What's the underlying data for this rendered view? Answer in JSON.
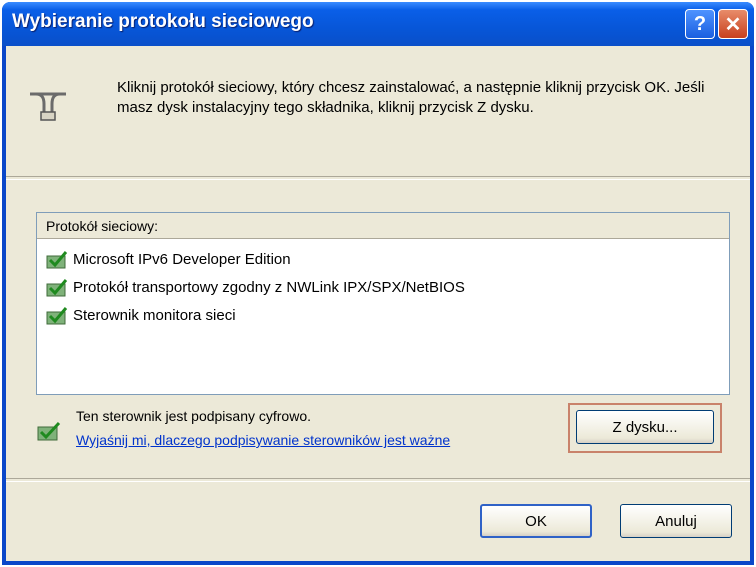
{
  "window": {
    "title": "Wybieranie protokołu sieciowego",
    "help_label": "?",
    "close_label": "✕"
  },
  "intro": {
    "text": "Kliknij protokół sieciowy, który chcesz zainstalować, a następnie kliknij przycisk OK. Jeśli masz dysk instalacyjny tego składnika, kliknij przycisk Z dysku."
  },
  "list": {
    "header": "Protokół sieciowy:",
    "items": [
      {
        "label": "Microsoft IPv6 Developer Edition",
        "icon": "network-protocol-icon"
      },
      {
        "label": "Protokół transportowy zgodny z NWLink IPX/SPX/NetBIOS",
        "icon": "network-protocol-icon"
      },
      {
        "label": "Sterownik monitora sieci",
        "icon": "network-protocol-icon"
      }
    ]
  },
  "signature": {
    "text": "Ten sterownik jest podpisany cyfrowo.",
    "link": "Wyjaśnij mi, dlaczego podpisywanie sterowników jest ważne"
  },
  "buttons": {
    "from_disk": "Z dysku...",
    "ok": "OK",
    "cancel": "Anuluj"
  },
  "colors": {
    "titlebar": "#0a5fe8",
    "dialog_bg": "#ece9d8",
    "link": "#0033cc"
  }
}
